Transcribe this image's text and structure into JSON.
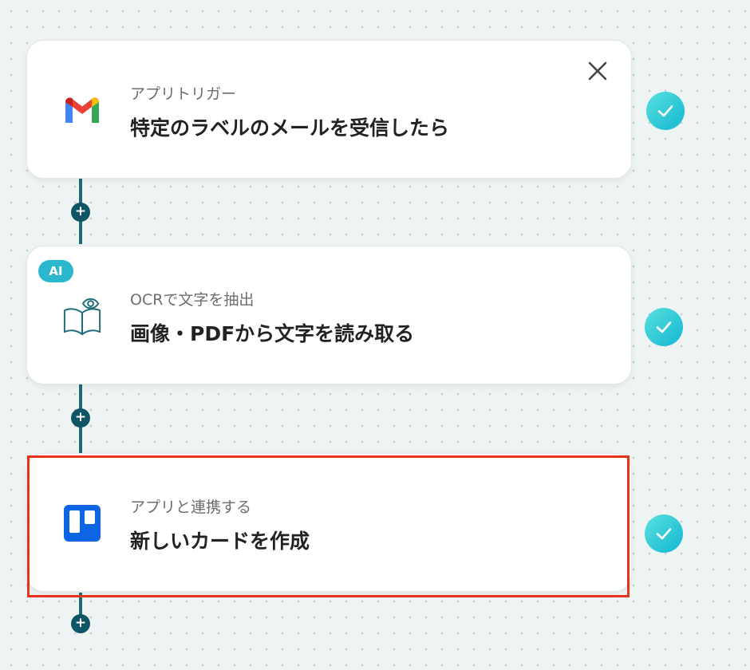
{
  "steps": [
    {
      "subtitle": "アプリトリガー",
      "title": "特定のラベルのメールを受信したら",
      "icon": "gmail-icon",
      "status": "completed"
    },
    {
      "badge": "AI",
      "subtitle": "OCRで文字を抽出",
      "title": "画像・PDFから文字を読み取る",
      "icon": "ocr-book-eye-icon",
      "status": "completed"
    },
    {
      "subtitle": "アプリと連携する",
      "title": "新しいカードを作成",
      "icon": "trello-icon",
      "status": "completed",
      "highlighted": true
    }
  ],
  "controls": {
    "add_step_symbol": "+",
    "close_icon": "close-icon",
    "check_icon": "check-icon"
  },
  "colors": {
    "connector": "#1b6a78",
    "add_button": "#0f5566",
    "ai_badge": "#2bb8cf",
    "check_gradient_start": "#5ae0de",
    "check_gradient_end": "#12b7d2",
    "highlight_border": "#e8321c",
    "gmail_red": "#ea4335",
    "gmail_blue": "#4285f4",
    "gmail_green": "#34a853",
    "gmail_yellow": "#fbbc04",
    "trello_blue": "#0c66e4"
  }
}
